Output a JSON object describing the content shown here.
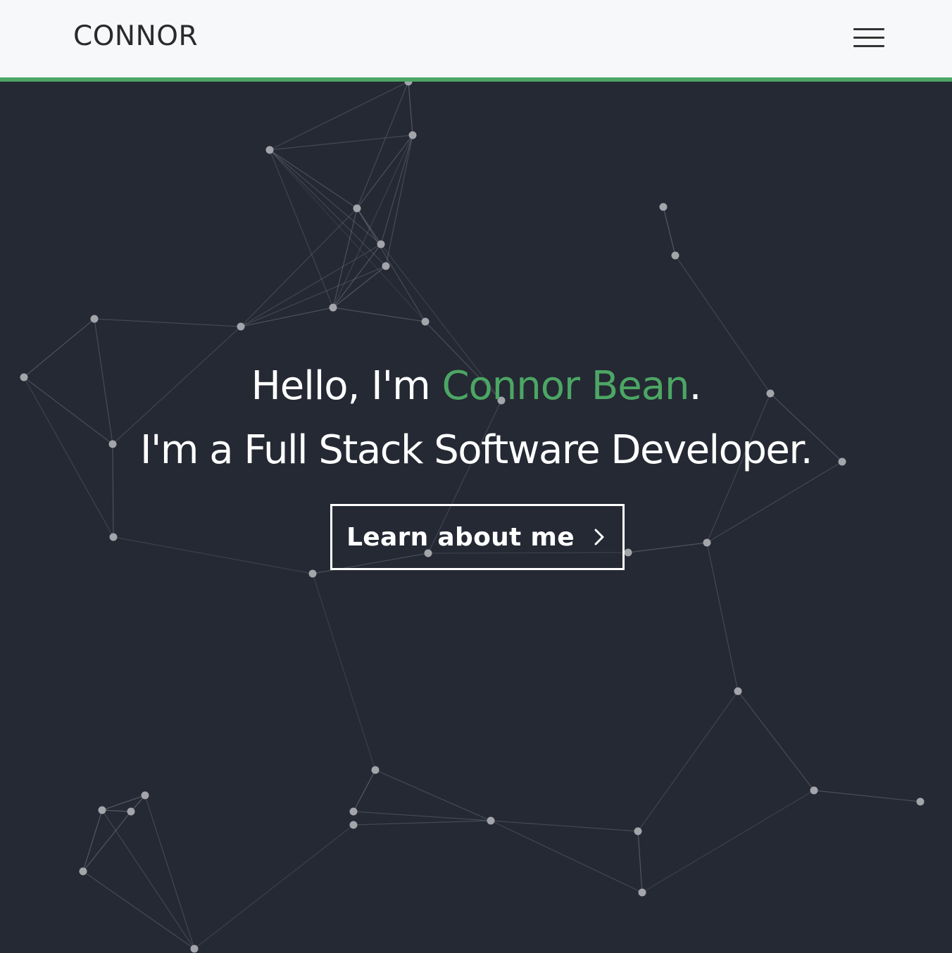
{
  "navbar": {
    "brand": "CONNOR",
    "menu_icon": "hamburger-menu-icon",
    "accent_color": "#4ca664"
  },
  "hero": {
    "background_color": "#252934",
    "greeting_prefix": "Hello, I'm ",
    "name": "Connor Bean",
    "greeting_suffix": ".",
    "tagline": "I'm a Full Stack Software Developer.",
    "cta_label": "Learn about me",
    "cta_icon": "chevron-right-icon",
    "name_color": "#4ca664"
  }
}
